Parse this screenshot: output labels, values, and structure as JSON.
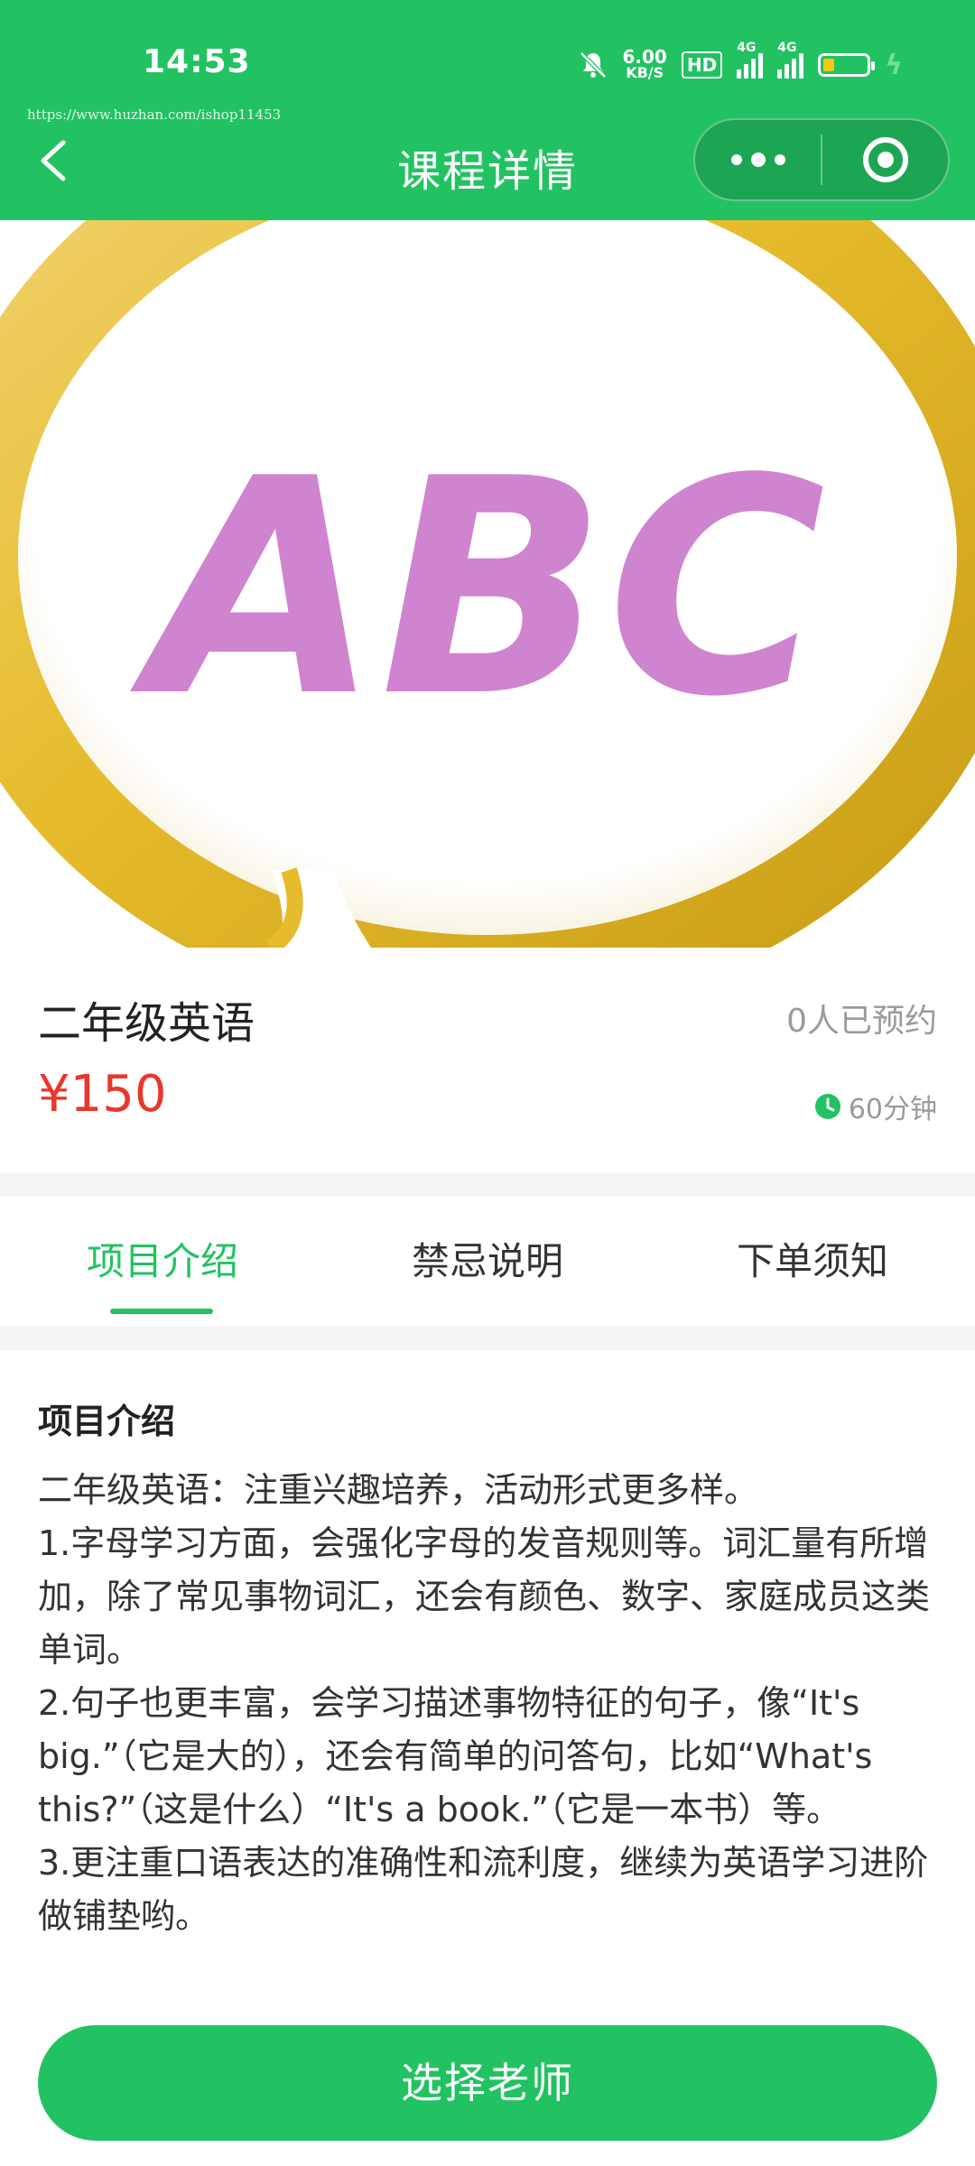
{
  "status_bar": {
    "time": "14:53",
    "speed_value": "6.00",
    "speed_unit": "KB/S",
    "hd_label": "HD",
    "signal1_label": "4G",
    "signal2_label": "4G",
    "battery_fill_fraction": 0.25
  },
  "watermark": "https://www.huzhan.com/ishop11453",
  "header": {
    "title": "课程详情"
  },
  "hero": {
    "image_text": "ABC"
  },
  "course": {
    "name": "二年级英语",
    "booked": "0人已预约",
    "price": "¥150",
    "duration": "60分钟"
  },
  "tabs": [
    {
      "label": "项目介绍",
      "active": true
    },
    {
      "label": "禁忌说明",
      "active": false
    },
    {
      "label": "下单须知",
      "active": false
    }
  ],
  "content": {
    "section_title": "项目介绍",
    "body": "二年级英语：注重兴趣培养，活动形式更多样。\n1.字母学习方面，会强化字母的发音规则等。词汇量有所增加，除了常见事物词汇，还会有颜色、数字、家庭成员这类单词。\n2.句子也更丰富，会学习描述事物特征的句子，像“It's big.”（它是大的），还会有简单的问答句，比如“What's this?”（这是什么）“It's a book.”（它是一本书）等。\n3.更注重口语表达的准确性和流利度，继续为英语学习进阶做铺垫哟。"
  },
  "cta": {
    "label": "选择老师"
  },
  "colors": {
    "brand_green": "#22c262",
    "price_red": "#e8372b",
    "muted_gray": "#9a9a9a",
    "abc_purple": "#cf84cf",
    "ring_gold": "#e6bb2c"
  }
}
